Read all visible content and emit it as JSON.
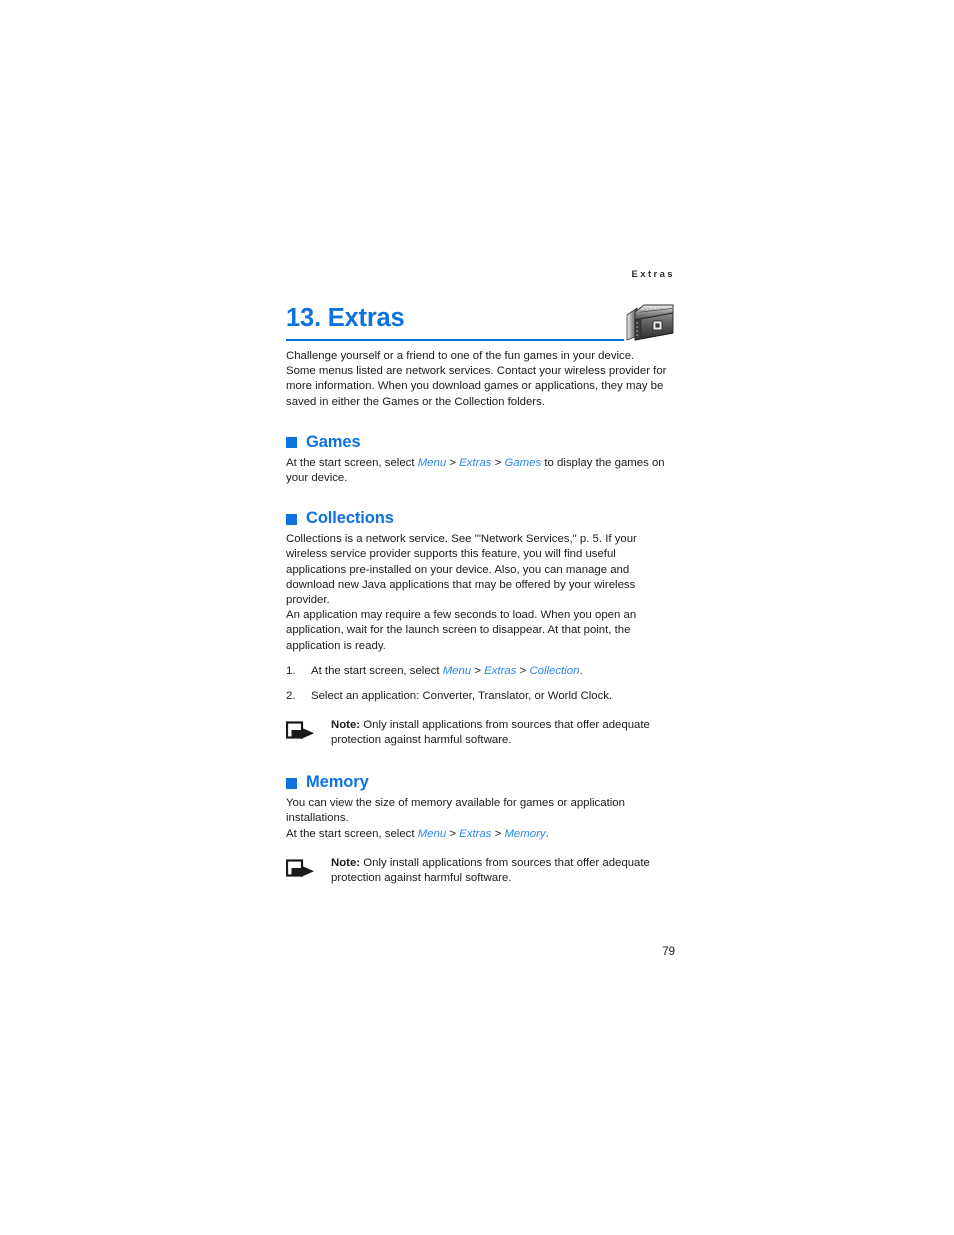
{
  "header": {
    "running_head": "Extras",
    "chapter_title": "13. Extras",
    "chapter_icon": "treasure-chest-icon",
    "accent_color": "#0b72e0",
    "link_color": "#2b86f0",
    "text_color": "#1c1c1c"
  },
  "intro": {
    "line1": "Challenge yourself or a friend to one of the fun games in your device.",
    "line2": "Some menus listed are network services. Contact your wireless provider for more information. When you download games or applications, they may be saved in either the Games or the Collection folders."
  },
  "sections": [
    {
      "id": "games",
      "bullet": "square-bullet-icon",
      "title": "Games",
      "paragraph": {
        "before": "At the start screen, select ",
        "ref1": "Menu",
        "sep1": " > ",
        "ref2": "Extras",
        "sep2": " > ",
        "ref3": "Games",
        "after": " to display the games on your device."
      }
    },
    {
      "id": "collections",
      "bullet": "square-bullet-icon",
      "title": "Collections",
      "paragraph1": "Collections is a network service. See '\"Network Services,\" p. 5. If your wireless service provider supports this feature, you will find useful applications pre-installed on your device. Also, you can manage and download new Java applications that may be offered by your wireless provider.",
      "paragraph2": "An application may require a few seconds to load. When you open an application, wait for the launch screen to disappear. At that point, the application is ready.",
      "steps": [
        {
          "num": "1.",
          "before": "At the start screen, select ",
          "ref1": "Menu",
          "sep1": " > ",
          "ref2": "Extras",
          "sep2": " > ",
          "ref3": "Collection",
          "after": "."
        },
        {
          "num": "2.",
          "text": "Select an application: Converter, Translator, or World Clock."
        }
      ],
      "note": {
        "icon": "note-arrow-icon",
        "label": "Note:",
        "text": " Only install applications from sources that offer adequate protection against harmful software."
      }
    },
    {
      "id": "memory",
      "bullet": "square-bullet-icon",
      "title": "Memory",
      "paragraph": {
        "line1": "You can view the size of memory available for games or application installations.",
        "before": "At the start screen, select ",
        "ref1": "Menu",
        "sep1": " > ",
        "ref2": "Extras",
        "sep2": " > ",
        "ref3": "Memory",
        "after": "."
      },
      "note": {
        "icon": "note-arrow-icon",
        "label": "Note:",
        "text": " Only install applications from sources that offer adequate protection against harmful software."
      }
    }
  ],
  "footer": {
    "page_number": "79"
  }
}
